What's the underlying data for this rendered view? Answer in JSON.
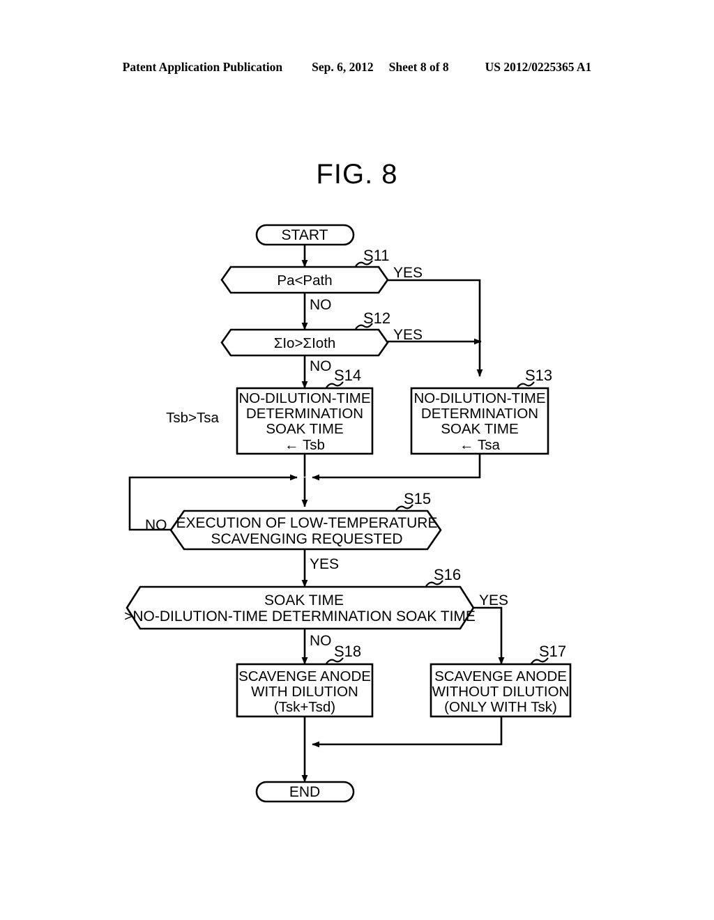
{
  "header": {
    "publication": "Patent Application Publication",
    "date": "Sep. 6, 2012",
    "sheet": "Sheet 8 of 8",
    "number": "US 2012/0225365 A1"
  },
  "figure": {
    "title": "FIG. 8"
  },
  "colors": {
    "ink": "#000000",
    "paper": "#ffffff"
  },
  "nodes": {
    "start": {
      "id": "start",
      "type": "terminal",
      "label": "START"
    },
    "s11": {
      "id": "S11",
      "type": "decision",
      "step": "S11",
      "label": "Pa<Path",
      "yes_label": "YES",
      "no_label": "NO"
    },
    "s12": {
      "id": "S12",
      "type": "decision",
      "step": "S12",
      "label": "ΣIo>ΣIoth",
      "yes_label": "YES",
      "no_label": "NO"
    },
    "s13": {
      "id": "S13",
      "type": "process",
      "step": "S13",
      "lines": [
        "NO-DILUTION-TIME",
        "DETERMINATION",
        "SOAK TIME",
        "← Tsa"
      ]
    },
    "s14": {
      "id": "S14",
      "type": "process",
      "step": "S14",
      "lines": [
        "NO-DILUTION-TIME",
        "DETERMINATION",
        "SOAK TIME",
        "← Tsb"
      ]
    },
    "s15": {
      "id": "S15",
      "type": "decision",
      "step": "S15",
      "lines": [
        "EXECUTION OF LOW-TEMPERATURE",
        "SCAVENGING REQUESTED"
      ],
      "yes_label": "YES",
      "no_label": "NO"
    },
    "s16": {
      "id": "S16",
      "type": "decision",
      "step": "S16",
      "lines": [
        "SOAK TIME",
        ">NO-DILUTION-TIME DETERMINATION SOAK TIME"
      ],
      "yes_label": "YES",
      "no_label": "NO"
    },
    "s17": {
      "id": "S17",
      "type": "process",
      "step": "S17",
      "lines": [
        "SCAVENGE ANODE",
        "WITHOUT DILUTION",
        "(ONLY WITH Tsk)"
      ]
    },
    "s18": {
      "id": "S18",
      "type": "process",
      "step": "S18",
      "lines": [
        "SCAVENGE ANODE",
        "WITH DILUTION",
        "(Tsk+Tsd)"
      ]
    },
    "end": {
      "id": "end",
      "type": "terminal",
      "label": "END"
    }
  },
  "annotations": {
    "tsb_tsa": "Tsb>Tsa"
  }
}
